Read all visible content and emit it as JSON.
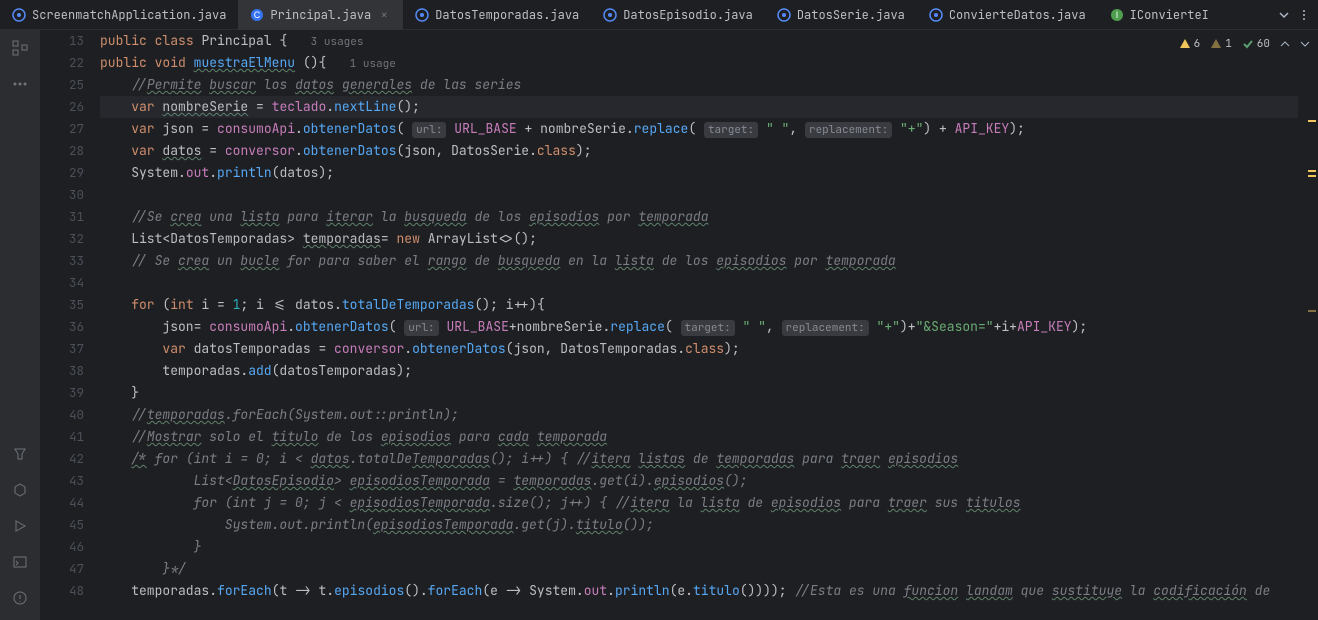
{
  "tabs": [
    {
      "name": "ScreenmatchApplication.java",
      "icon": "java"
    },
    {
      "name": "Principal.java",
      "icon": "class",
      "active": true,
      "closable": true
    },
    {
      "name": "DatosTemporadas.java",
      "icon": "java"
    },
    {
      "name": "DatosEpisodio.java",
      "icon": "java"
    },
    {
      "name": "DatosSerie.java",
      "icon": "java"
    },
    {
      "name": "ConvierteDatos.java",
      "icon": "java"
    },
    {
      "name": "IConvierteI",
      "icon": "interface"
    }
  ],
  "badges": {
    "warn_yellow": "6",
    "warn_weak": "1",
    "check": "60"
  },
  "gutter": [
    "13",
    "22",
    "25",
    "26",
    "27",
    "28",
    "29",
    "30",
    "31",
    "32",
    "33",
    "34",
    "35",
    "36",
    "37",
    "38",
    "39",
    "40",
    "41",
    "42",
    "43",
    "44",
    "45",
    "46",
    "47",
    "48"
  ],
  "usages": {
    "class": "3 usages",
    "method": "1 usage"
  },
  "t": {
    "public": "public",
    "class": "class",
    "void": "void",
    "var": "var",
    "for": "for",
    "int": "int",
    "new": "new",
    "Principal": "Principal",
    "muestraElMenu": "muestraElMenu",
    "c25": "//Permite buscar los datos generales de las series",
    "nombreSerie": "nombreSerie",
    "teclado": "teclado",
    "nextLine": "nextLine",
    "json": "json",
    "consumoApi": "consumoApi",
    "obtenerDatos": "obtenerDatos",
    "url": "url:",
    "URL_BASE": "URL_BASE",
    "replace": "replace",
    "target": "target:",
    "replacement": "replacement:",
    "sp": "\" \"",
    "plus": "\"+\"",
    "API_KEY": "API_KEY",
    "datos": "datos",
    "conversor": "conversor",
    "DatosSerie": "DatosSerie",
    "classkw": "class",
    "System": "System",
    "out": "out",
    "println": "println",
    "c31": "//Se crea una lista para iterar la busqueda de los episodios por temporada",
    "List": "List",
    "DatosTemporadas": "DatosTemporadas",
    "temporadas": "temporadas",
    "ArrayList": "ArrayList",
    "c33": "// Se crea un bucle for para saber el rango de busqueda en la lista de los episodios por temporada",
    "i": "i",
    "totalDeTemporadas": "totalDeTemporadas",
    "season": "\"&Season=\"",
    "datosTemporadas": "datosTemporadas",
    "add": "add",
    "c40": "//temporadas.forEach(System.out::println);",
    "c41": "//Mostrar solo el titulo de los episodios para cada temporada",
    "c42": "/* for (int i = 0; i < datos.totalDeTemporadas(); i++) { //itera listas de temporadas para traer episodios",
    "c43": "        List<DatosEpisodio> episodiosTemporada = temporadas.get(i).episodios();",
    "c44": "        for (int j = 0; j < episodiosTemporada.size(); j++) { //itera la lista de episodios para traer sus titulos",
    "c45": "            System.out.println(episodiosTemporada.get(j).titulo());",
    "c46": "        }",
    "c47": "    }*/",
    "forEach": "forEach",
    "t48": "t",
    "episodios": "episodios",
    "e48": "e",
    "titulo": "titulo",
    "c48": "//Esta es una funcion landam que sustituye la codificación de"
  }
}
